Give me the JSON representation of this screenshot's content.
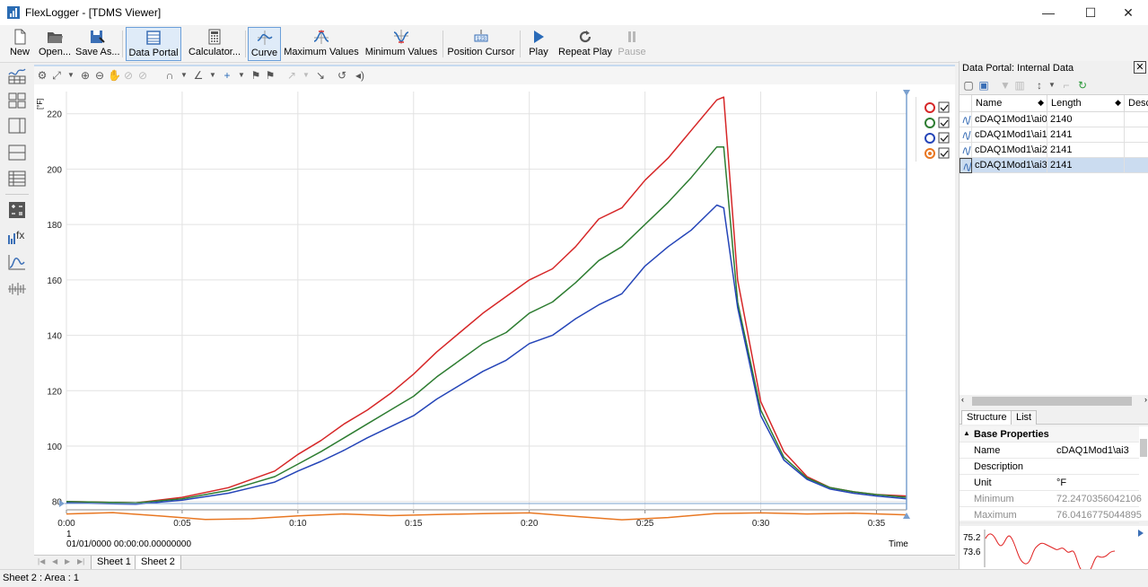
{
  "window": {
    "title": "FlexLogger - [TDMS Viewer]",
    "minimize": "—",
    "maximize": "☐",
    "close": "✕"
  },
  "ribbon": {
    "new": "New",
    "open": "Open...",
    "save_as": "Save As...",
    "data_portal": "Data Portal",
    "calculator": "Calculator...",
    "curve": "Curve",
    "maximum_values": "Maximum Values",
    "minimum_values": "Minimum Values",
    "position_cursor": "Position Cursor",
    "play": "Play",
    "repeat_play": "Repeat Play",
    "pause": "Pause"
  },
  "chart": {
    "y_unit": "[°F]",
    "x_label": "Time",
    "x_start_index": "1",
    "x_start_date": "01/01/0000 00:00:00.00000000"
  },
  "chart_data": {
    "type": "line",
    "xlabel": "Time",
    "ylabel": "[°F]",
    "xlim": [
      0,
      36.3
    ],
    "ylim": [
      77,
      228
    ],
    "x_ticks": [
      "0:00",
      "0:05",
      "0:10",
      "0:15",
      "0:20",
      "0:25",
      "0:30",
      "0:35"
    ],
    "y_ticks": [
      "80",
      "100",
      "120",
      "140",
      "160",
      "180",
      "200",
      "220"
    ],
    "grid": true,
    "series": [
      {
        "color": "#d62728",
        "x": [
          0,
          3,
          5,
          7,
          8,
          9,
          10,
          11,
          12,
          13,
          14,
          15,
          16,
          17,
          18,
          19,
          20,
          21,
          22,
          23,
          24,
          25,
          26,
          27,
          28.1,
          28.4,
          29,
          30,
          31,
          32,
          33,
          34,
          35,
          36.3
        ],
        "values": [
          80,
          79.5,
          81.5,
          85,
          88,
          91,
          97,
          102,
          108,
          113,
          119,
          126,
          134,
          141,
          148,
          154,
          160,
          164,
          172,
          182,
          186,
          196,
          204,
          214,
          225,
          226,
          160,
          116,
          98,
          89,
          85,
          83.5,
          82.5,
          82
        ]
      },
      {
        "color": "#2e7d32",
        "x": [
          0,
          3,
          5,
          7,
          8,
          9,
          10,
          11,
          12,
          13,
          14,
          15,
          16,
          17,
          18,
          19,
          20,
          21,
          22,
          23,
          24,
          25,
          26,
          27,
          28.1,
          28.4,
          29,
          30,
          31,
          32,
          33,
          34,
          35,
          36.3
        ],
        "values": [
          80,
          79.5,
          81,
          84,
          86.5,
          89,
          93.5,
          98,
          103,
          108,
          113,
          118,
          125,
          131,
          137,
          141,
          148,
          152,
          159,
          167,
          172,
          180,
          188,
          197,
          208,
          208,
          152,
          113,
          96,
          88.5,
          85,
          83.5,
          82.5,
          81.5
        ]
      },
      {
        "color": "#2545b8",
        "x": [
          0,
          3,
          5,
          7,
          8,
          9,
          10,
          11,
          12,
          13,
          14,
          15,
          16,
          17,
          18,
          19,
          20,
          21,
          22,
          23,
          24,
          25,
          26,
          27,
          28.1,
          28.4,
          29,
          30,
          31,
          32,
          33,
          34,
          35,
          36.3
        ],
        "values": [
          79.5,
          79,
          80.5,
          83,
          85,
          87,
          91,
          94.5,
          98.5,
          103,
          107,
          111,
          117,
          122,
          127,
          131,
          137,
          140,
          146,
          151,
          155,
          165,
          172,
          178,
          187,
          186,
          150,
          111,
          95,
          88,
          84.5,
          83,
          82,
          81
        ]
      },
      {
        "color": "#e87722",
        "x": [
          0,
          2,
          4,
          6,
          8,
          10,
          12,
          14,
          16,
          18,
          20,
          22,
          24,
          26,
          28,
          30,
          32,
          34,
          36.3
        ],
        "values": [
          75.5,
          76,
          74.8,
          73.5,
          73.8,
          74.8,
          75.5,
          74.9,
          75.3,
          75.6,
          75.9,
          74.6,
          73.4,
          74.2,
          75.6,
          75.9,
          75.5,
          75.8,
          75.2
        ]
      }
    ]
  },
  "legend": {
    "items": [
      {
        "color": "#d62728"
      },
      {
        "color": "#2e7d32"
      },
      {
        "color": "#2545b8"
      },
      {
        "color": "#e87722"
      }
    ]
  },
  "sheets": {
    "tab1": "Sheet 1",
    "tab2": "Sheet 2"
  },
  "status": {
    "text": "Sheet 2 : Area : 1"
  },
  "data_portal": {
    "title": "Data Portal: Internal Data",
    "close": "✕",
    "columns": [
      "Name",
      "Length",
      "Desc"
    ],
    "rows": [
      {
        "name": "cDAQ1Mod1\\ai0",
        "length": "2140"
      },
      {
        "name": "cDAQ1Mod1\\ai1",
        "length": "2141"
      },
      {
        "name": "cDAQ1Mod1\\ai2",
        "length": "2141"
      },
      {
        "name": "cDAQ1Mod1\\ai3",
        "length": "2141"
      }
    ],
    "view_tabs": [
      "Structure",
      "List"
    ],
    "props_header": "Base Properties",
    "props": [
      {
        "key": "Name",
        "value": "cDAQ1Mod1\\ai3"
      },
      {
        "key": "Description",
        "value": ""
      },
      {
        "key": "Unit",
        "value": "°F"
      },
      {
        "key": "Minimum",
        "value": "72.2470356042106"
      },
      {
        "key": "Maximum",
        "value": "76.0416775044895"
      }
    ],
    "mini_y_ticks": [
      "75.2",
      "73.6"
    ]
  }
}
